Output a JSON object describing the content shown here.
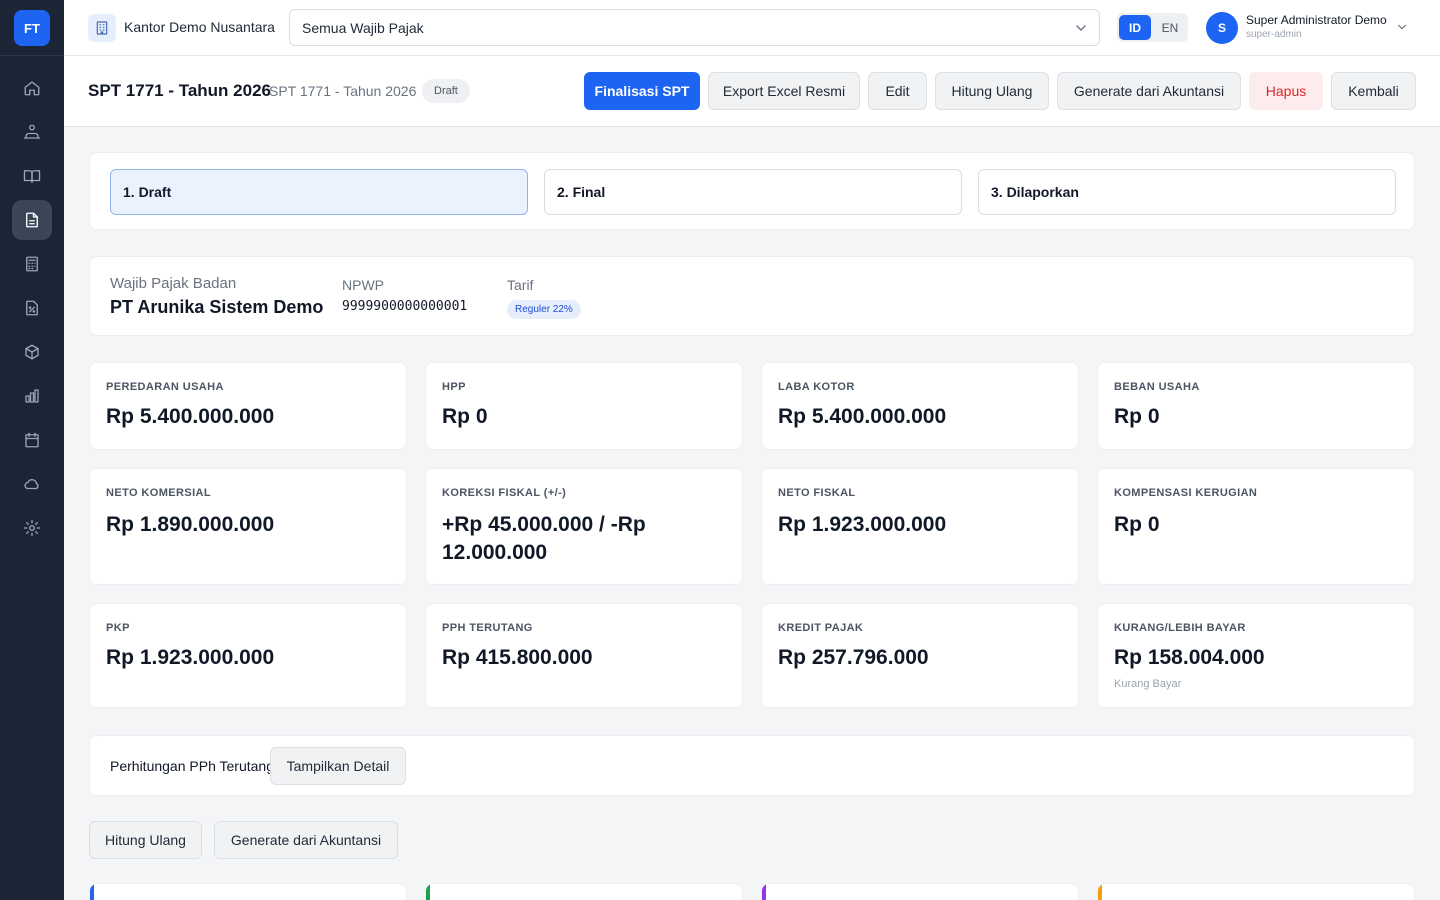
{
  "app": {
    "logo": "FT"
  },
  "sidebar": {
    "items": [
      {
        "icon": "home-icon"
      },
      {
        "icon": "users-icon"
      },
      {
        "icon": "book-icon"
      },
      {
        "icon": "document-icon",
        "active": true
      },
      {
        "icon": "calculator-icon"
      },
      {
        "icon": "tax-receipt-icon"
      },
      {
        "icon": "box-icon"
      },
      {
        "icon": "chart-icon"
      },
      {
        "icon": "calendar-icon"
      },
      {
        "icon": "cloud-icon"
      },
      {
        "icon": "gear-icon"
      }
    ]
  },
  "topbar": {
    "office": "Kantor Demo Nusantara",
    "taxpayer_select": "Semua Wajib Pajak",
    "lang": {
      "id": "ID",
      "en": "EN",
      "active": "ID"
    },
    "user": {
      "initial": "S",
      "name": "Super Administrator Demo",
      "role": "super-admin"
    }
  },
  "header": {
    "title": "SPT 1771 - Tahun 2026",
    "subtitle": "SPT 1771 - Tahun 2026",
    "status": "Draft",
    "buttons": {
      "finalize": "Finalisasi SPT",
      "export": "Export Excel Resmi",
      "edit": "Edit",
      "recalc": "Hitung Ulang",
      "generate": "Generate dari Akuntansi",
      "delete": "Hapus",
      "back": "Kembali"
    }
  },
  "steps": [
    "1. Draft",
    "2. Final",
    "3. Dilaporkan"
  ],
  "taxpayer": {
    "type_label": "Wajib Pajak Badan",
    "name": "PT Arunika Sistem Demo",
    "npwp_label": "NPWP",
    "npwp": "9999900000000001",
    "tariff_label": "Tarif",
    "tariff": "Reguler 22%"
  },
  "stats": [
    {
      "label": "PEREDARAN USAHA",
      "value": "Rp 5.400.000.000"
    },
    {
      "label": "HPP",
      "value": "Rp 0"
    },
    {
      "label": "LABA KOTOR",
      "value": "Rp 5.400.000.000"
    },
    {
      "label": "BEBAN USAHA",
      "value": "Rp 0"
    },
    {
      "label": "NETO KOMERSIAL",
      "value": "Rp 1.890.000.000"
    },
    {
      "label": "KOREKSI FISKAL (+/-)",
      "value": "+Rp 45.000.000 / -Rp 12.000.000"
    },
    {
      "label": "NETO FISKAL",
      "value": "Rp 1.923.000.000"
    },
    {
      "label": "KOMPENSASI KERUGIAN",
      "value": "Rp 0"
    },
    {
      "label": "PKP",
      "value": "Rp 1.923.000.000"
    },
    {
      "label": "PPH TERUTANG",
      "value": "Rp 415.800.000"
    },
    {
      "label": "KREDIT PAJAK",
      "value": "Rp 257.796.000"
    },
    {
      "label": "KURANG/LEBIH BAYAR",
      "value": "Rp 158.004.000",
      "note": "Kurang Bayar"
    }
  ],
  "calc": {
    "title": "Perhitungan PPh Terutang",
    "toggle": "Tampilkan Detail"
  },
  "actions": {
    "recalc": "Hitung Ulang",
    "generate": "Generate dari Akuntansi"
  },
  "accent_colors": [
    "#2563eb",
    "#16a34a",
    "#9333ea",
    "#f59e0b"
  ]
}
